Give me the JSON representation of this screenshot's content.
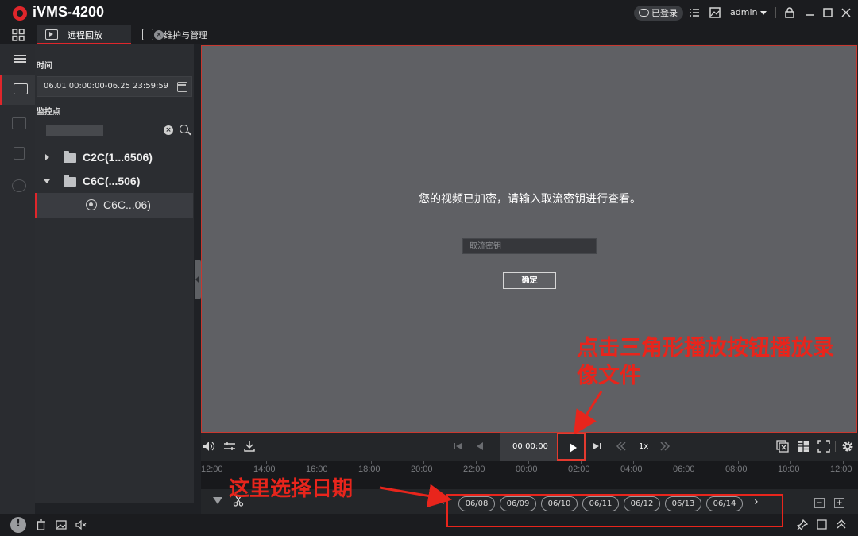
{
  "app": {
    "title": "iVMS-4200"
  },
  "titlebar": {
    "login_status": "已登录",
    "user": "admin"
  },
  "tabs": [
    {
      "label": "远程回放",
      "active": true
    },
    {
      "label": "维护与管理",
      "active": false
    }
  ],
  "left_panel": {
    "time_label": "时间",
    "time_range": "06.01 00:00:00-06.25 23:59:59",
    "monitor_label": "监控点",
    "search_value": "",
    "tree": [
      {
        "label": "C2C(1...6506)",
        "expanded": false
      },
      {
        "label": "C6C(...506)",
        "expanded": true
      },
      {
        "label": "C6C...06)",
        "type": "camera",
        "selected": true
      }
    ]
  },
  "video": {
    "message": "您的视频已加密，请输入取流密钥进行查看。",
    "key_placeholder": "取流密钥",
    "confirm_label": "确定"
  },
  "controls": {
    "time": "00:00:00",
    "speed": "1x"
  },
  "timeline": {
    "ticks": [
      "12:00",
      "14:00",
      "16:00",
      "18:00",
      "20:00",
      "22:00",
      "00:00",
      "02:00",
      "04:00",
      "06:00",
      "08:00",
      "10:00",
      "12:00"
    ]
  },
  "dates": [
    "06/08",
    "06/09",
    "06/10",
    "06/11",
    "06/12",
    "06/13",
    "06/14"
  ],
  "annotations": {
    "play_hint": "点击三角形播放按钮播放录像文件",
    "date_hint": "这里选择日期"
  },
  "colors": {
    "accent": "#e0262b",
    "annotation": "#e8251c",
    "video_bg": "#5f6064"
  }
}
